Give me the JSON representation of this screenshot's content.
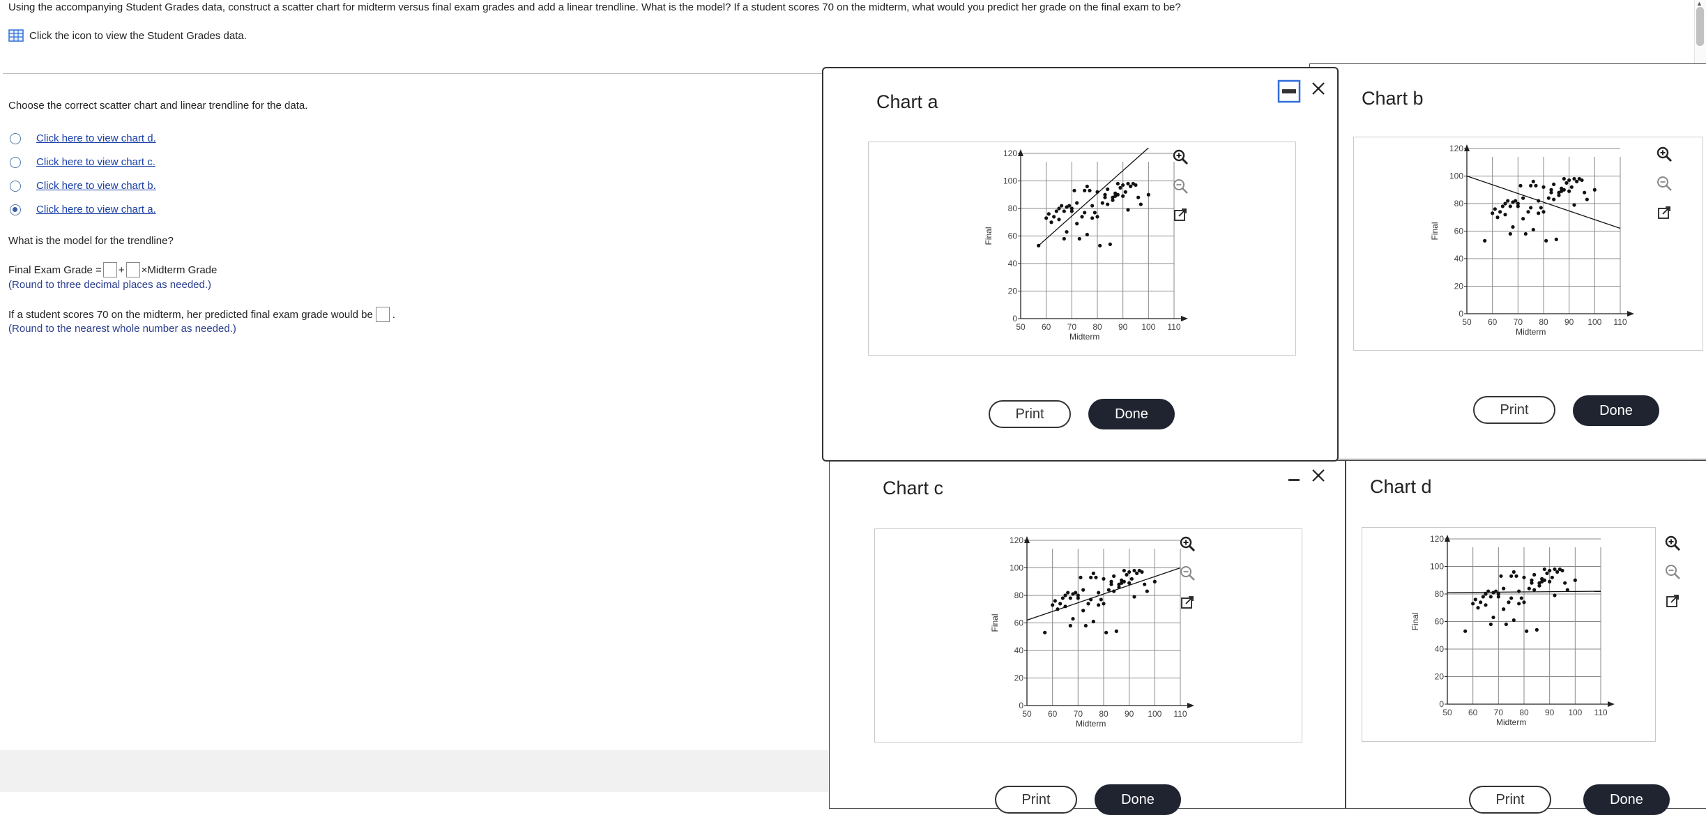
{
  "question": "Using the accompanying Student Grades data, construct a scatter chart for midterm versus final exam grades and add a linear trendline. What is the model? If a student scores 70 on the midterm, what would you predict her grade on the final exam to be?",
  "data_link": "Click the icon to view the Student Grades data.",
  "choose_prompt": "Choose the correct scatter chart and linear trendline for the data.",
  "options": [
    {
      "label": "Click here to view chart d.",
      "selected": false
    },
    {
      "label": "Click here to view chart c.",
      "selected": false
    },
    {
      "label": "Click here to view chart b.",
      "selected": false
    },
    {
      "label": "Click here to view chart a.",
      "selected": true
    }
  ],
  "model_prompt": "What is the model for the trendline?",
  "equation": {
    "lhs": "Final Exam Grade =",
    "plus": "+",
    "rhs": "×Midterm Grade"
  },
  "round_hint_1": "(Round to three decimal places as needed.)",
  "predict_prompt": "If a student scores 70 on the midterm, her predicted final exam grade would be",
  "predict_end": ".",
  "round_hint_2": "(Round to the nearest whole number as needed.)",
  "print_label": "Print",
  "done_label": "Done",
  "chart_data": [
    {
      "id": "a",
      "title": "Chart a",
      "type": "scatter",
      "xlabel": "Midterm",
      "ylabel": "Final",
      "xticks": [
        50,
        60,
        70,
        80,
        90,
        100,
        110
      ],
      "yticks": [
        0,
        20,
        40,
        60,
        80,
        100,
        120
      ],
      "xlim": [
        50,
        110
      ],
      "ylim": [
        0,
        120
      ],
      "grid": true,
      "trendline": {
        "x": [
          57,
          100
        ],
        "y": [
          53,
          124
        ]
      },
      "points": [
        [
          57,
          53
        ],
        [
          60,
          73
        ],
        [
          61,
          76
        ],
        [
          62,
          70
        ],
        [
          63,
          74
        ],
        [
          64,
          78
        ],
        [
          65,
          72
        ],
        [
          65,
          80
        ],
        [
          66,
          82
        ],
        [
          67,
          78
        ],
        [
          67,
          58
        ],
        [
          68,
          63
        ],
        [
          68,
          81
        ],
        [
          69,
          82
        ],
        [
          70,
          78
        ],
        [
          70,
          80
        ],
        [
          71,
          93
        ],
        [
          72,
          69
        ],
        [
          72,
          84
        ],
        [
          73,
          58
        ],
        [
          74,
          74
        ],
        [
          75,
          77
        ],
        [
          75,
          93
        ],
        [
          76,
          61
        ],
        [
          76,
          96
        ],
        [
          77,
          93
        ],
        [
          78,
          82
        ],
        [
          78,
          73
        ],
        [
          79,
          77
        ],
        [
          80,
          74
        ],
        [
          80,
          92
        ],
        [
          81,
          53
        ],
        [
          82,
          84
        ],
        [
          83,
          88
        ],
        [
          83,
          90
        ],
        [
          84,
          83
        ],
        [
          84,
          94
        ],
        [
          85,
          54
        ],
        [
          86,
          88
        ],
        [
          86,
          86
        ],
        [
          87,
          91
        ],
        [
          87,
          89
        ],
        [
          88,
          90
        ],
        [
          88,
          98
        ],
        [
          89,
          95
        ],
        [
          90,
          97
        ],
        [
          90,
          89
        ],
        [
          91,
          92
        ],
        [
          92,
          98
        ],
        [
          92,
          79
        ],
        [
          93,
          96
        ],
        [
          94,
          98
        ],
        [
          95,
          97
        ],
        [
          96,
          88
        ],
        [
          97,
          83
        ],
        [
          100,
          90
        ]
      ]
    },
    {
      "id": "b",
      "title": "Chart b",
      "type": "scatter",
      "xlabel": "Midterm",
      "ylabel": "Final",
      "xticks": [
        50,
        60,
        70,
        80,
        90,
        100,
        110
      ],
      "yticks": [
        0,
        20,
        40,
        60,
        80,
        100,
        120
      ],
      "xlim": [
        50,
        110
      ],
      "ylim": [
        0,
        120
      ],
      "grid": true,
      "trendline": {
        "x": [
          50,
          110
        ],
        "y": [
          100,
          62
        ]
      },
      "points": [
        [
          57,
          53
        ],
        [
          60,
          73
        ],
        [
          61,
          76
        ],
        [
          62,
          70
        ],
        [
          63,
          74
        ],
        [
          64,
          78
        ],
        [
          65,
          72
        ],
        [
          65,
          80
        ],
        [
          66,
          82
        ],
        [
          67,
          78
        ],
        [
          67,
          58
        ],
        [
          68,
          63
        ],
        [
          68,
          81
        ],
        [
          69,
          82
        ],
        [
          70,
          78
        ],
        [
          70,
          80
        ],
        [
          71,
          93
        ],
        [
          72,
          69
        ],
        [
          72,
          84
        ],
        [
          73,
          58
        ],
        [
          74,
          74
        ],
        [
          75,
          77
        ],
        [
          75,
          93
        ],
        [
          76,
          61
        ],
        [
          76,
          96
        ],
        [
          77,
          93
        ],
        [
          78,
          82
        ],
        [
          78,
          73
        ],
        [
          79,
          77
        ],
        [
          80,
          74
        ],
        [
          80,
          92
        ],
        [
          81,
          53
        ],
        [
          82,
          84
        ],
        [
          83,
          88
        ],
        [
          83,
          90
        ],
        [
          84,
          83
        ],
        [
          84,
          94
        ],
        [
          85,
          54
        ],
        [
          86,
          88
        ],
        [
          86,
          86
        ],
        [
          87,
          91
        ],
        [
          87,
          89
        ],
        [
          88,
          90
        ],
        [
          88,
          98
        ],
        [
          89,
          95
        ],
        [
          90,
          97
        ],
        [
          90,
          89
        ],
        [
          91,
          92
        ],
        [
          92,
          98
        ],
        [
          92,
          79
        ],
        [
          93,
          96
        ],
        [
          94,
          98
        ],
        [
          95,
          97
        ],
        [
          96,
          88
        ],
        [
          97,
          83
        ],
        [
          100,
          90
        ]
      ]
    },
    {
      "id": "c",
      "title": "Chart c",
      "type": "scatter",
      "xlabel": "Midterm",
      "ylabel": "Final",
      "xticks": [
        50,
        60,
        70,
        80,
        90,
        100,
        110
      ],
      "yticks": [
        0,
        20,
        40,
        60,
        80,
        100,
        120
      ],
      "xlim": [
        50,
        110
      ],
      "ylim": [
        0,
        120
      ],
      "grid": true,
      "trendline": {
        "x": [
          50,
          110
        ],
        "y": [
          62,
          100
        ]
      },
      "points": [
        [
          57,
          53
        ],
        [
          60,
          73
        ],
        [
          61,
          76
        ],
        [
          62,
          70
        ],
        [
          63,
          74
        ],
        [
          64,
          78
        ],
        [
          65,
          72
        ],
        [
          65,
          80
        ],
        [
          66,
          82
        ],
        [
          67,
          78
        ],
        [
          67,
          58
        ],
        [
          68,
          63
        ],
        [
          68,
          81
        ],
        [
          69,
          82
        ],
        [
          70,
          78
        ],
        [
          70,
          80
        ],
        [
          71,
          93
        ],
        [
          72,
          69
        ],
        [
          72,
          84
        ],
        [
          73,
          58
        ],
        [
          74,
          74
        ],
        [
          75,
          77
        ],
        [
          75,
          93
        ],
        [
          76,
          61
        ],
        [
          76,
          96
        ],
        [
          77,
          93
        ],
        [
          78,
          82
        ],
        [
          78,
          73
        ],
        [
          79,
          77
        ],
        [
          80,
          74
        ],
        [
          80,
          92
        ],
        [
          81,
          53
        ],
        [
          82,
          84
        ],
        [
          83,
          88
        ],
        [
          83,
          90
        ],
        [
          84,
          83
        ],
        [
          84,
          94
        ],
        [
          85,
          54
        ],
        [
          86,
          88
        ],
        [
          86,
          86
        ],
        [
          87,
          91
        ],
        [
          87,
          89
        ],
        [
          88,
          90
        ],
        [
          88,
          98
        ],
        [
          89,
          95
        ],
        [
          90,
          97
        ],
        [
          90,
          89
        ],
        [
          91,
          92
        ],
        [
          92,
          98
        ],
        [
          92,
          79
        ],
        [
          93,
          96
        ],
        [
          94,
          98
        ],
        [
          95,
          97
        ],
        [
          96,
          88
        ],
        [
          97,
          83
        ],
        [
          100,
          90
        ]
      ]
    },
    {
      "id": "d",
      "title": "Chart d",
      "type": "scatter",
      "xlabel": "Midterm",
      "ylabel": "Final",
      "xticks": [
        50,
        60,
        70,
        80,
        90,
        100,
        110
      ],
      "yticks": [
        0,
        20,
        40,
        60,
        80,
        100,
        120
      ],
      "xlim": [
        50,
        110
      ],
      "ylim": [
        0,
        120
      ],
      "grid": true,
      "trendline": {
        "x": [
          50,
          110
        ],
        "y": [
          81,
          82
        ]
      },
      "points": [
        [
          57,
          53
        ],
        [
          60,
          73
        ],
        [
          61,
          76
        ],
        [
          62,
          70
        ],
        [
          63,
          74
        ],
        [
          64,
          78
        ],
        [
          65,
          72
        ],
        [
          65,
          80
        ],
        [
          66,
          82
        ],
        [
          67,
          78
        ],
        [
          67,
          58
        ],
        [
          68,
          63
        ],
        [
          68,
          81
        ],
        [
          69,
          82
        ],
        [
          70,
          78
        ],
        [
          70,
          80
        ],
        [
          71,
          93
        ],
        [
          72,
          69
        ],
        [
          72,
          84
        ],
        [
          73,
          58
        ],
        [
          74,
          74
        ],
        [
          75,
          77
        ],
        [
          75,
          93
        ],
        [
          76,
          61
        ],
        [
          76,
          96
        ],
        [
          77,
          93
        ],
        [
          78,
          82
        ],
        [
          78,
          73
        ],
        [
          79,
          77
        ],
        [
          80,
          74
        ],
        [
          80,
          92
        ],
        [
          81,
          53
        ],
        [
          82,
          84
        ],
        [
          83,
          88
        ],
        [
          83,
          90
        ],
        [
          84,
          83
        ],
        [
          84,
          94
        ],
        [
          85,
          54
        ],
        [
          86,
          88
        ],
        [
          86,
          86
        ],
        [
          87,
          91
        ],
        [
          87,
          89
        ],
        [
          88,
          90
        ],
        [
          88,
          98
        ],
        [
          89,
          95
        ],
        [
          90,
          97
        ],
        [
          90,
          89
        ],
        [
          91,
          92
        ],
        [
          92,
          98
        ],
        [
          92,
          79
        ],
        [
          93,
          96
        ],
        [
          94,
          98
        ],
        [
          95,
          97
        ],
        [
          96,
          88
        ],
        [
          97,
          83
        ],
        [
          100,
          90
        ]
      ]
    }
  ]
}
